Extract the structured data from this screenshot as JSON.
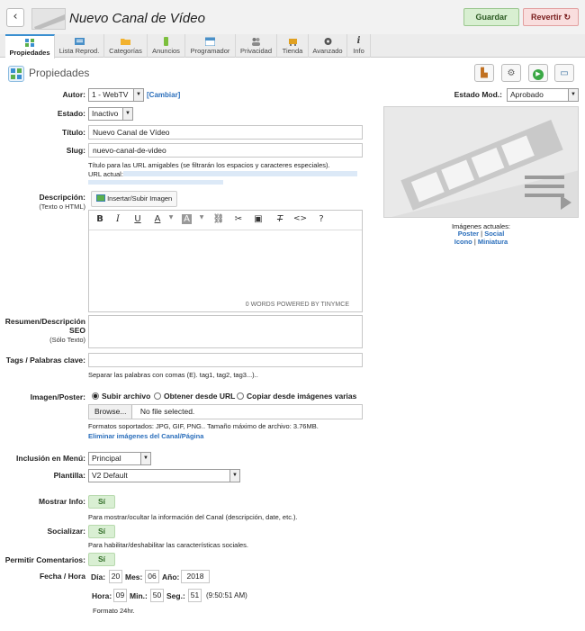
{
  "header": {
    "title": "Nuevo Canal de Vídeo",
    "save_label": "Guardar",
    "revert_label": "Revertir"
  },
  "tabs": [
    {
      "label": "Propiedades",
      "icon": "properties-icon",
      "active": true
    },
    {
      "label": "Lista Reprod.",
      "icon": "playlist-icon"
    },
    {
      "label": "Categorías",
      "icon": "folder-icon"
    },
    {
      "label": "Anuncios",
      "icon": "ads-icon"
    },
    {
      "label": "Programador",
      "icon": "calendar-icon"
    },
    {
      "label": "Privacidad",
      "icon": "users-icon"
    },
    {
      "label": "Tienda",
      "icon": "cart-icon"
    },
    {
      "label": "Avanzado",
      "icon": "gear-icon"
    },
    {
      "label": "Info",
      "icon": "info-icon"
    }
  ],
  "section": {
    "title": "Propiedades"
  },
  "form": {
    "autor_label": "Autor:",
    "autor_value": "1 - WebTV",
    "autor_change": "[Cambiar]",
    "estado_mod_label": "Estado Mod.:",
    "estado_mod_value": "Aprobado",
    "estado_label": "Estado:",
    "estado_value": "Inactivo",
    "titulo_label": "Título:",
    "titulo_value": "Nuevo Canal de Vídeo",
    "slug_label": "Slug:",
    "slug_value": "nuevo-canal-de-video",
    "slug_hint": "Título para las URL amigables (se filtrarán los espacios y caracteres especiales).",
    "url_label": "URL actual:",
    "desc_label": "Descripción:",
    "desc_sub": "(Texto o HTML)",
    "insert_image": "Insertar/Subir Imagen",
    "editor_status": "0 WORDS POWERED BY TINYMCE",
    "seo_label": "Resumen/Descripción SEO",
    "seo_sub": "(Sólo Texto)",
    "tags_label": "Tags / Palabras clave:",
    "tags_hint": "Separar las palabras con comas (E). tag1, tag2, tag3...)..",
    "image_label": "Imagen/Poster:",
    "radio_upload": "Subir archivo",
    "radio_url": "Obtener desde URL",
    "radio_copy": "Copiar desde imágenes varias",
    "browse": "Browse...",
    "no_file": "No file selected.",
    "formats_hint": "Formatos soportados: JPG, GIF, PNG.. Tamaño máximo de archivo: 3.76MB.",
    "delete_images": "Eliminar imágenes del Canal/Página",
    "menu_label": "Inclusión en Menú:",
    "menu_value": "Principal",
    "template_label": "Plantilla:",
    "template_value": "V2 Default",
    "showinfo_label": "Mostrar Info:",
    "showinfo_value": "Sí",
    "showinfo_hint": "Para mostrar/ocultar la información del Canal (descripción, date, etc.).",
    "social_label": "Socializar:",
    "social_value": "Sí",
    "social_hint": "Para habilitar/deshabilitar las características sociales.",
    "comments_label": "Permitir Comentarios:",
    "comments_value": "Sí",
    "datetime_label": "Fecha / Hora",
    "dia_label": "Día:",
    "dia_value": "20",
    "mes_label": "Mes:",
    "mes_value": "06",
    "anio_label": "Año:",
    "anio_value": "2018",
    "hora_label": "Hora:",
    "hora_value": "09",
    "min_label": "Min.:",
    "min_value": "50",
    "seg_label": "Seg.:",
    "seg_value": "51",
    "time_display": "(9:50:51 AM)",
    "format_24": "Formato 24hr."
  },
  "images": {
    "current_label": "Imágenes actuales:",
    "poster": "Poster",
    "social": "Social",
    "icono": "Icono",
    "miniatura": "Miniatura"
  }
}
